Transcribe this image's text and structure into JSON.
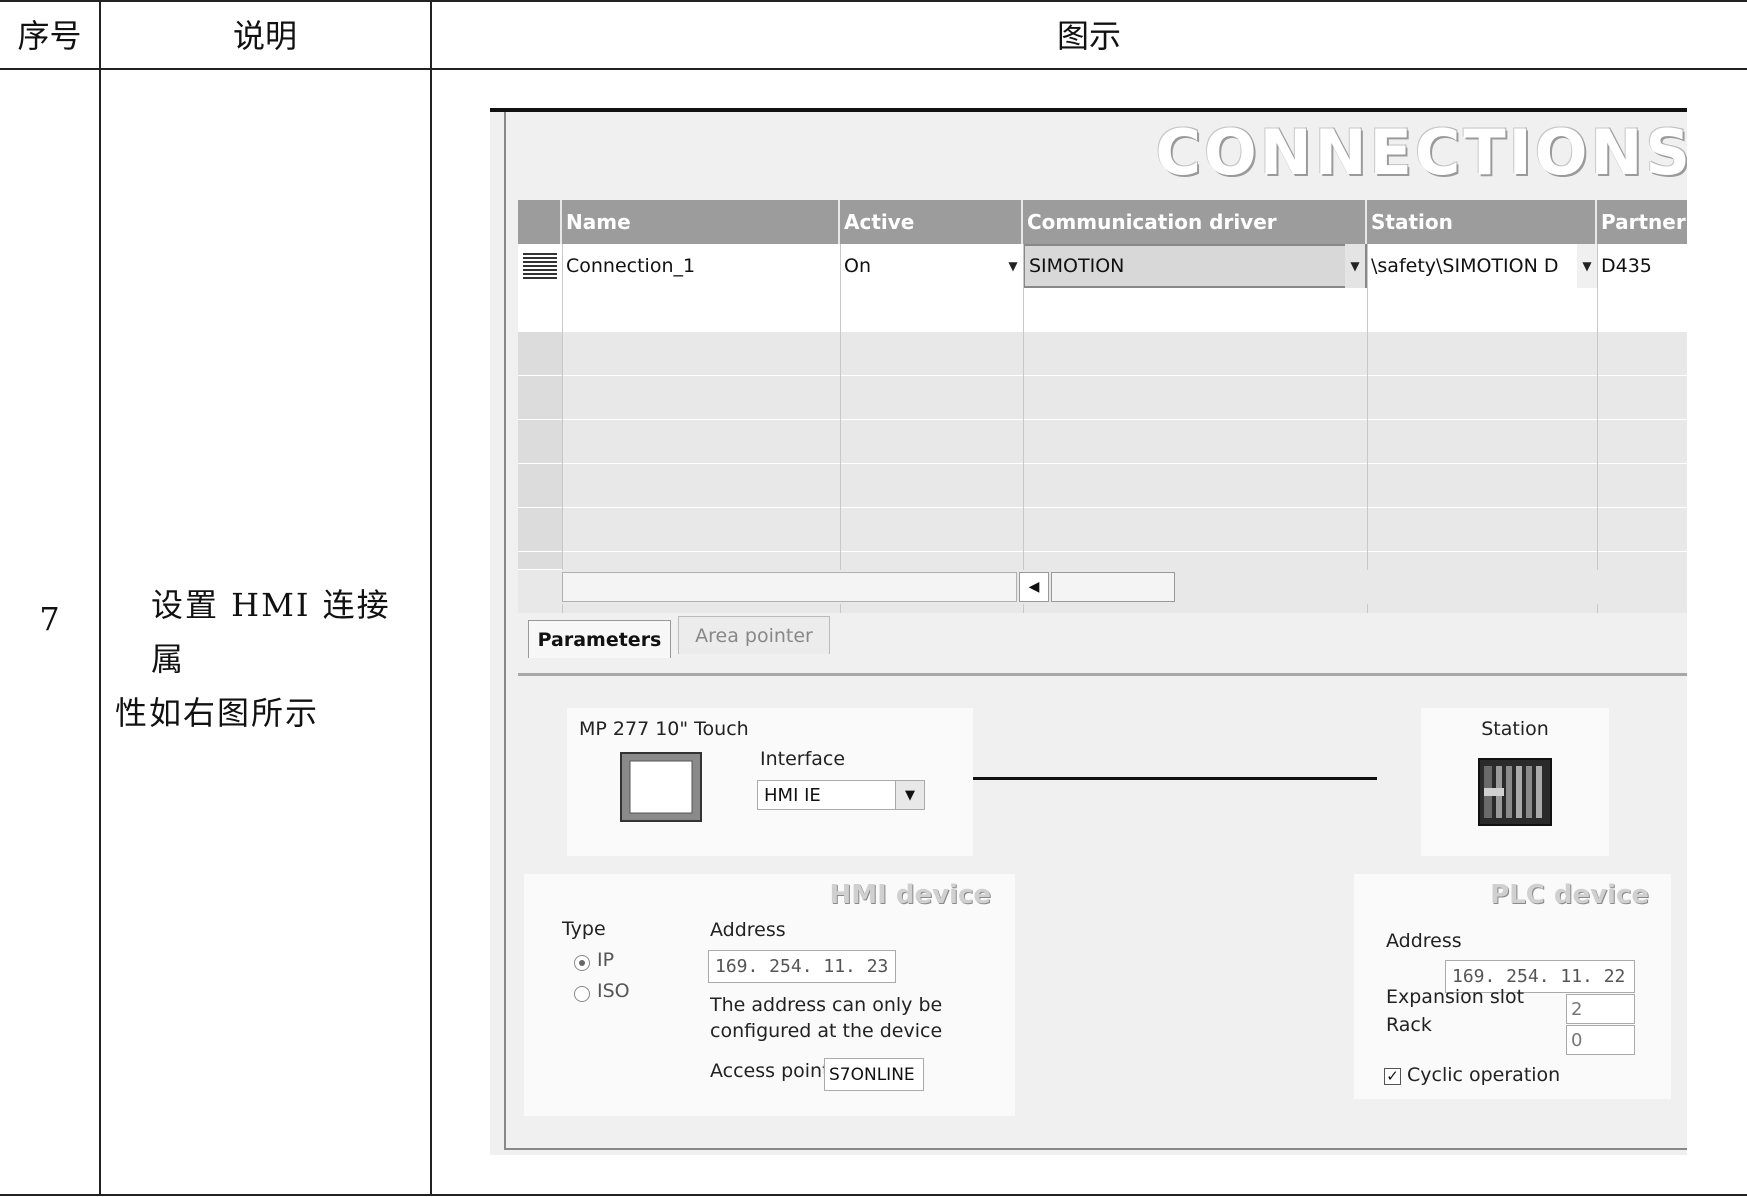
{
  "table": {
    "headers": {
      "seq": "序号",
      "desc": "说明",
      "figure": "图示"
    },
    "row": {
      "seq": "7",
      "desc_line1": "设置 HMI 连接属",
      "desc_line2": "性如右图所示"
    }
  },
  "screenshot": {
    "banner": "CONNECTIONS",
    "grid": {
      "columns": [
        "Name",
        "Active",
        "Communication driver",
        "Station",
        "Partner"
      ],
      "rows": [
        {
          "name": "Connection_1",
          "active": "On",
          "driver": "SIMOTION",
          "station": "\\safety\\SIMOTION D",
          "partner": "D435"
        }
      ]
    },
    "tabs": {
      "parameters": "Parameters",
      "area_pointer": "Area pointer"
    },
    "hmi_panel": {
      "device_name": "MP 277 10\" Touch",
      "interface_label": "Interface",
      "interface_value": "HMI IE"
    },
    "station_panel": {
      "label": "Station"
    },
    "hmi_device": {
      "title": "HMI device",
      "type_label": "Type",
      "type_ip": "IP",
      "type_iso": "ISO",
      "address_label": "Address",
      "address_value": "169. 254.  11.  23",
      "note_line1": "The address can only be",
      "note_line2": "configured at the device",
      "access_point_label": "Access point",
      "access_point_value": "S7ONLINE"
    },
    "plc_device": {
      "title": "PLC device",
      "address_label": "Address",
      "address_value": "169. 254.  11.  22",
      "expansion_slot_label": "Expansion slot",
      "expansion_slot_value": "2",
      "rack_label": "Rack",
      "rack_value": "0",
      "cyclic_label": "Cyclic operation",
      "cyclic_checked": true
    },
    "icons": [
      "dropdown-arrow-icon",
      "scroll-left-icon",
      "hmi-panel-icon",
      "plc-station-icon",
      "row-selector-icon",
      "checkbox-checked-icon",
      "radio-icon"
    ]
  }
}
